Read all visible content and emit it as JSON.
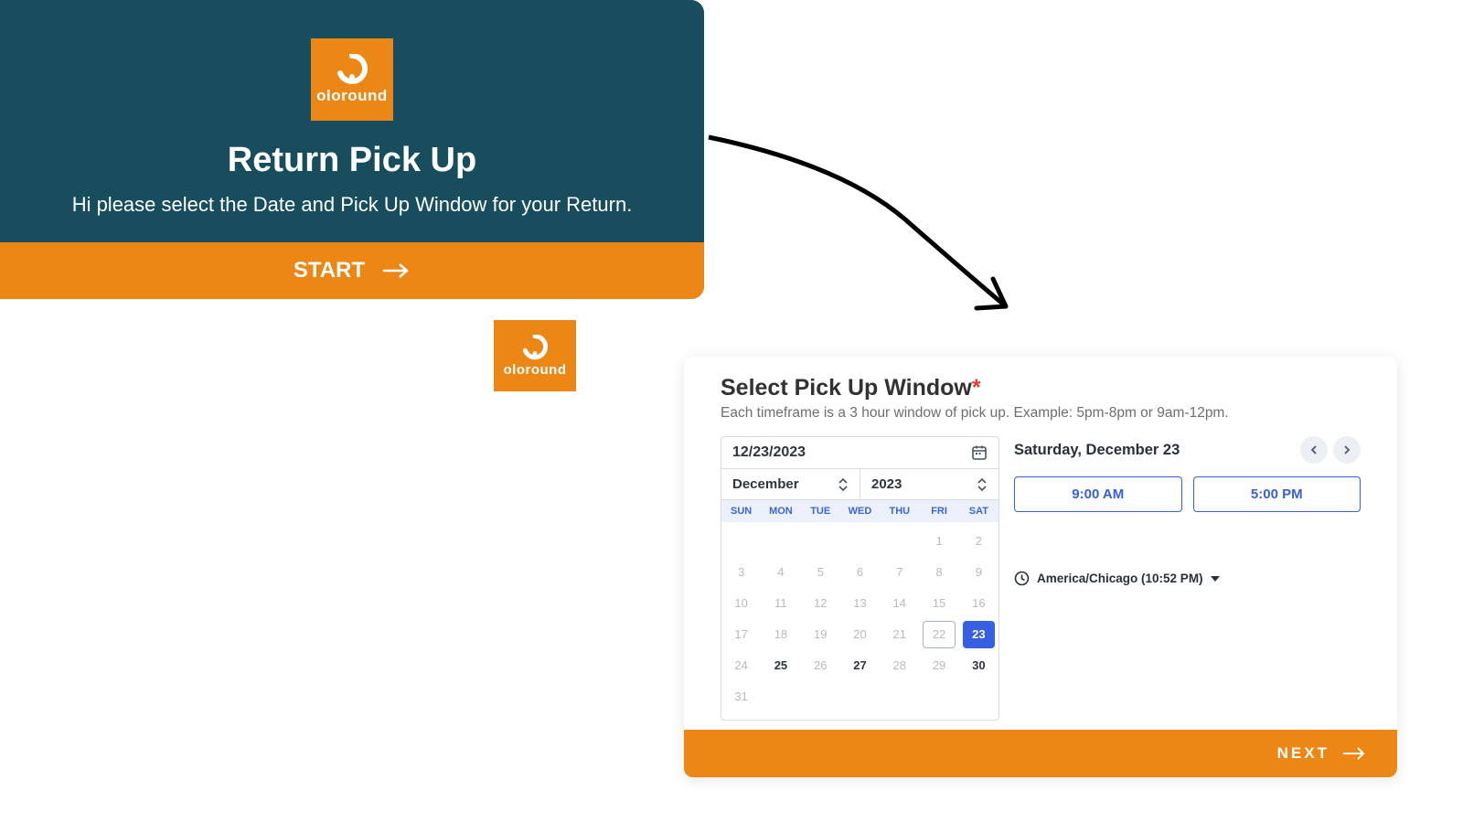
{
  "brand": {
    "name": "oloround"
  },
  "card1": {
    "title": "Return Pick Up",
    "subtitle": "Hi please select the Date and Pick Up Window for your Return.",
    "cta": "START"
  },
  "card2": {
    "title": "Select Pick Up Window",
    "required_marker": "*",
    "subtitle": "Each timeframe is a 3 hour window of pick up. Example: 5pm-8pm or 9am-12pm.",
    "date_input": "12/23/2023",
    "month": "December",
    "year": "2023",
    "dow": [
      "SUN",
      "MON",
      "TUE",
      "WED",
      "THU",
      "FRI",
      "SAT"
    ],
    "days": [
      {
        "n": "",
        "s": "blank"
      },
      {
        "n": "",
        "s": "blank"
      },
      {
        "n": "",
        "s": "blank"
      },
      {
        "n": "",
        "s": "blank"
      },
      {
        "n": "",
        "s": "blank"
      },
      {
        "n": "1",
        "s": "past"
      },
      {
        "n": "2",
        "s": "past"
      },
      {
        "n": "3",
        "s": "past"
      },
      {
        "n": "4",
        "s": "past"
      },
      {
        "n": "5",
        "s": "past"
      },
      {
        "n": "6",
        "s": "past"
      },
      {
        "n": "7",
        "s": "past"
      },
      {
        "n": "8",
        "s": "past"
      },
      {
        "n": "9",
        "s": "past"
      },
      {
        "n": "10",
        "s": "past"
      },
      {
        "n": "11",
        "s": "past"
      },
      {
        "n": "12",
        "s": "past"
      },
      {
        "n": "13",
        "s": "past"
      },
      {
        "n": "14",
        "s": "past"
      },
      {
        "n": "15",
        "s": "past"
      },
      {
        "n": "16",
        "s": "past"
      },
      {
        "n": "17",
        "s": "past"
      },
      {
        "n": "18",
        "s": "past"
      },
      {
        "n": "19",
        "s": "past"
      },
      {
        "n": "20",
        "s": "past"
      },
      {
        "n": "21",
        "s": "past"
      },
      {
        "n": "22",
        "s": "today"
      },
      {
        "n": "23",
        "s": "selected"
      },
      {
        "n": "24",
        "s": "past"
      },
      {
        "n": "25",
        "s": "active"
      },
      {
        "n": "26",
        "s": "past"
      },
      {
        "n": "27",
        "s": "active"
      },
      {
        "n": "28",
        "s": "past"
      },
      {
        "n": "29",
        "s": "past"
      },
      {
        "n": "30",
        "s": "active"
      },
      {
        "n": "31",
        "s": "past"
      }
    ],
    "selected_date_label": "Saturday, December 23",
    "slots": [
      "9:00 AM",
      "5:00 PM"
    ],
    "timezone": "America/Chicago (10:52 PM)",
    "cta": "NEXT"
  }
}
